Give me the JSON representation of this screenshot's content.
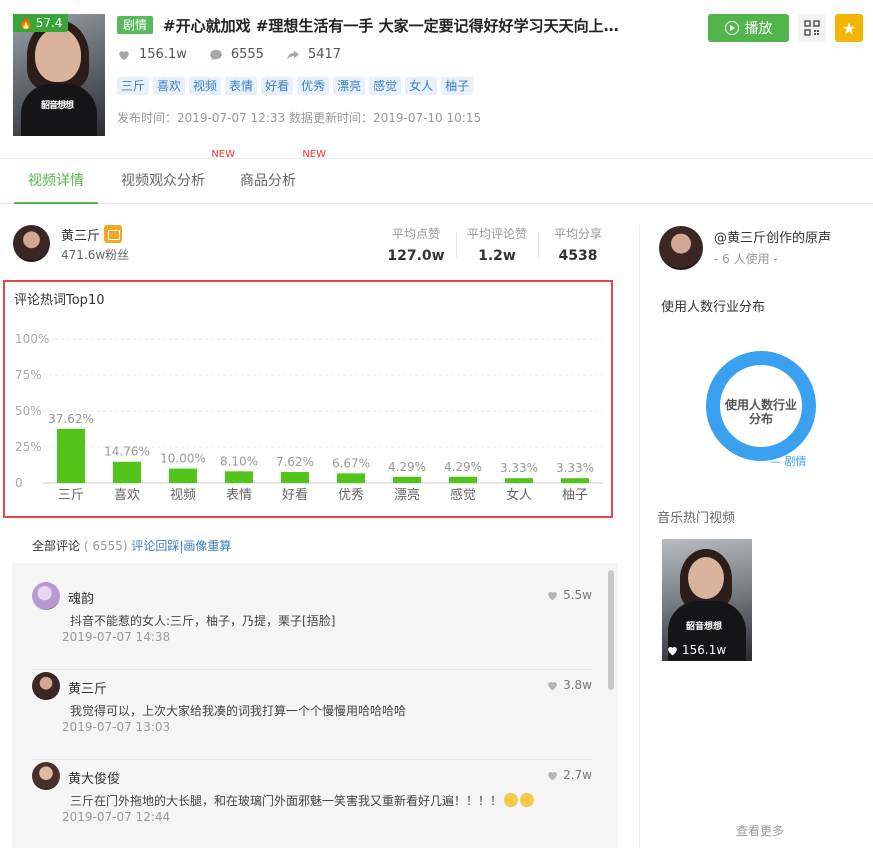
{
  "video": {
    "score": "57.4",
    "category_tag": "剧情",
    "title": "#开心就加戏 #理想生活有一手 大家一定要记得好好学习天天向上！...",
    "likes": "156.1w",
    "comments": "6555",
    "shares": "5417",
    "tags": [
      "三斤",
      "喜欢",
      "视频",
      "表情",
      "好看",
      "优秀",
      "漂亮",
      "感觉",
      "女人",
      "柚子"
    ],
    "publish_info": "发布时间：2019-07-07 12:33 数据更新时间：2019-07-10 10:15",
    "play_label": "播放"
  },
  "tabs": [
    {
      "label": "视频详情",
      "badge": ""
    },
    {
      "label": "视频观众分析",
      "badge": "NEW"
    },
    {
      "label": "商品分析",
      "badge": "NEW"
    }
  ],
  "author": {
    "name": "黄三斤",
    "fans": "471.6w粉丝",
    "metrics": [
      {
        "label": "平均点赞",
        "value": "127.0w"
      },
      {
        "label": "平均评论赞",
        "value": "1.2w"
      },
      {
        "label": "平均分享",
        "value": "4538"
      }
    ]
  },
  "chart_box_title": "评论热词Top10",
  "chart_data": {
    "type": "bar",
    "title": "评论热词Top10",
    "categories": [
      "三斤",
      "喜欢",
      "视频",
      "表情",
      "好看",
      "优秀",
      "漂亮",
      "感觉",
      "女人",
      "柚子"
    ],
    "values": [
      37.62,
      14.76,
      10.0,
      8.1,
      7.62,
      6.67,
      4.29,
      4.29,
      3.33,
      3.33
    ],
    "value_labels": [
      "37.62%",
      "14.76%",
      "10.00%",
      "8.10%",
      "7.62%",
      "6.67%",
      "4.29%",
      "4.29%",
      "3.33%",
      "3.33%"
    ],
    "yticks": [
      "0",
      "25%",
      "50%",
      "75%",
      "100%"
    ],
    "ylim": [
      0,
      100
    ],
    "grid": true,
    "color": "#52c41a"
  },
  "comments_section": {
    "label": "全部评论",
    "count": "( 6555)",
    "links": "评论回踩|画像重算",
    "items": [
      {
        "name": "魂韵",
        "likes": "5.5w",
        "text": "抖音不能惹的女人:三斤，柚子，乃提，栗子[捂脸]",
        "time": "2019-07-07 14:38"
      },
      {
        "name": "黄三斤",
        "likes": "3.8w",
        "text": "我觉得可以，上次大家给我凑的词我打算一个个慢慢用哈哈哈哈",
        "time": "2019-07-07 13:03"
      },
      {
        "name": "黄大俊俊",
        "likes": "2.7w",
        "text": "三斤在门外拖地的大长腿，和在玻璃门外面邪魅一笑害我又重新看好几遍！！！！",
        "time": "2019-07-07 12:44"
      }
    ]
  },
  "right_panel": {
    "music_name": "@黄三斤创作的原声",
    "users": "- 6 人使用 -",
    "dist_title": "使用人数行业分布",
    "donut_label": "使用人数行业分布",
    "legend": "剧情",
    "hot_title": "音乐热门视频",
    "hot_video_likes": "156.1w",
    "more": "查看更多"
  },
  "colors": {
    "accent_green": "#52b54b",
    "chip_blue": "#3b7fc4",
    "highlight_red": "#e24a4a",
    "donut_blue": "#3aa0f0"
  }
}
